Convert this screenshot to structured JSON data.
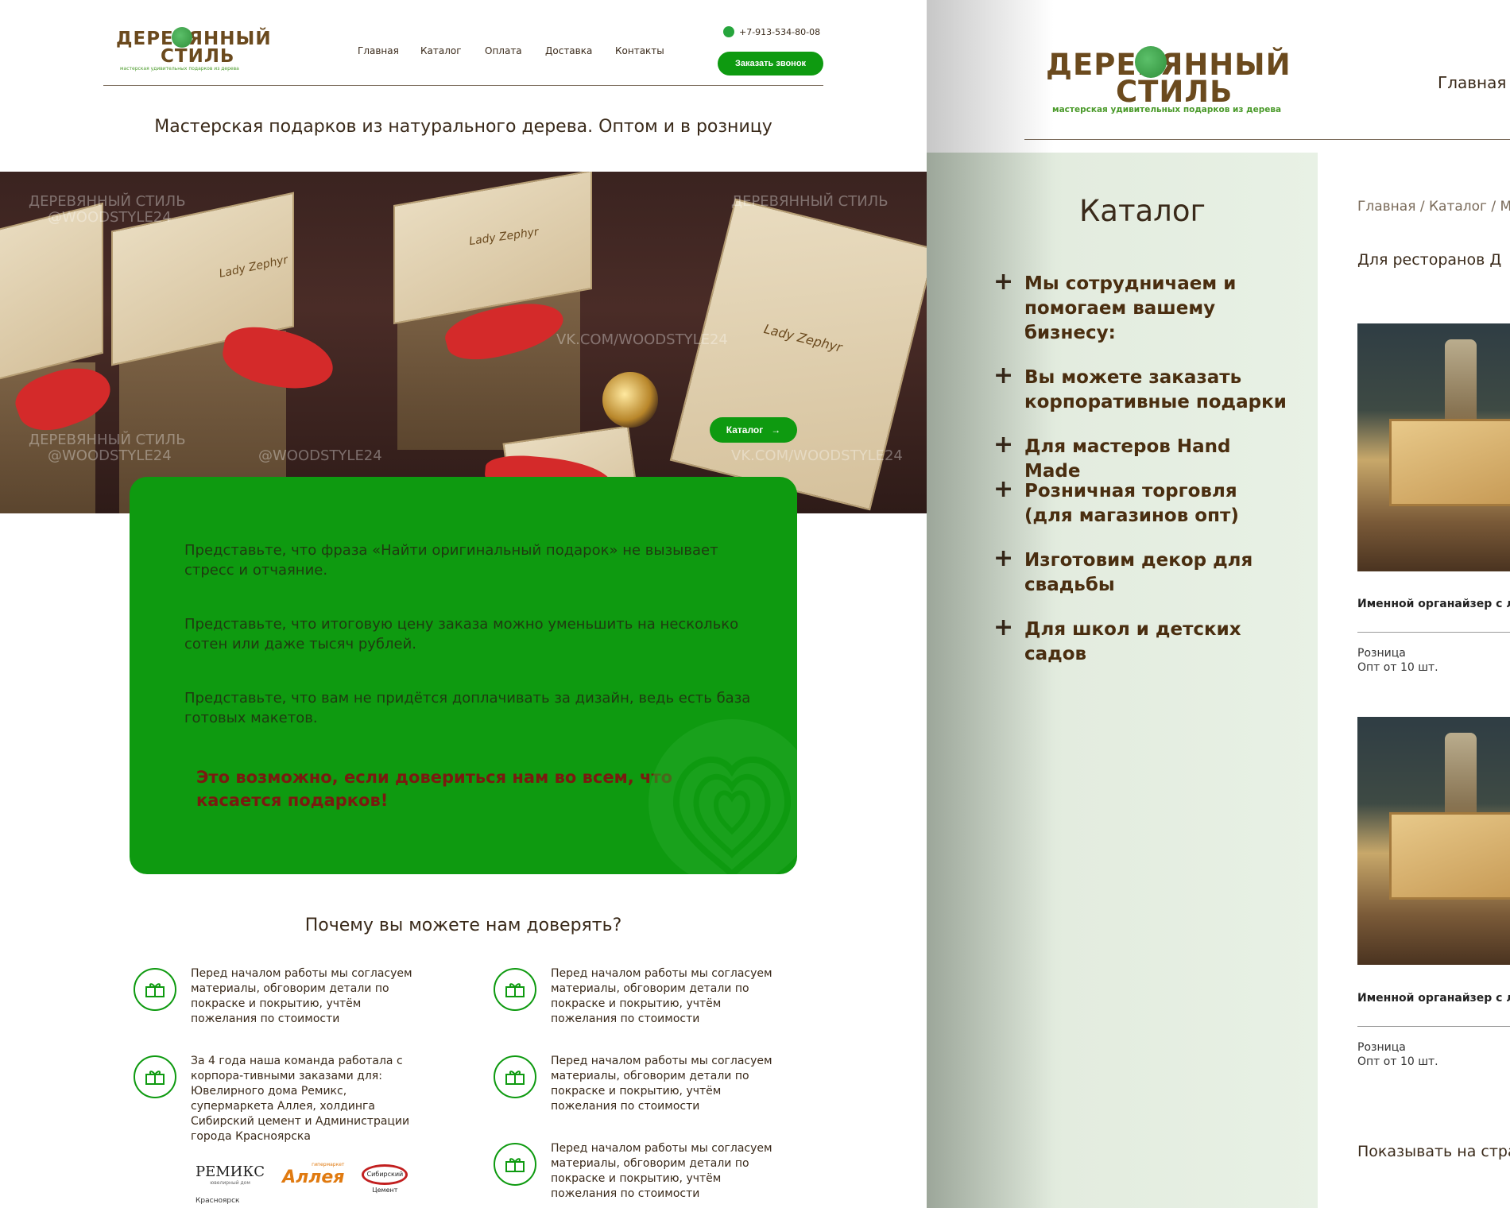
{
  "left": {
    "logo": {
      "line1": "ДЕРЕВЯННЫЙ",
      "line2": "СТИЛЬ",
      "sub": "мастерская удивительных подарков из дерева"
    },
    "nav": [
      "Главная",
      "Каталог",
      "Оплата",
      "Доставка",
      "Контакты"
    ],
    "phone": "+7-913-534-80-08",
    "call_button": "Заказать звонок",
    "tagline": "Мастерская подарков из натурального дерева. Оптом и в розницу",
    "hero": {
      "catalog_button": "Каталог",
      "watermarks": [
        "ДЕРЕВЯННЫЙ СТИЛЬ",
        "@WOODSTYLE24",
        "VK.COM/WOODSTYLE24"
      ],
      "box_labels": [
        "Lady Zephyr"
      ]
    },
    "card": {
      "p1": "Представьте, что фраза «Найти оригинальный подарок» не вызывает стресс и отчаяние.",
      "p2": "Представьте, что итоговую цену заказа можно уменьшить на несколько сотен или даже тысяч рублей.",
      "p3": "Представьте, что вам не придётся доплачивать за дизайн, ведь есть база готовых макетов.",
      "strong": "Это возможно, если довериться нам во всем, что касается подарков!"
    },
    "why": {
      "title": "Почему вы можете нам доверять?",
      "features": [
        "Перед началом работы мы согласуем материалы, обговорим детали по покраске и покрытию, учтём пожелания по стоимости",
        "Перед началом работы мы согласуем материалы, обговорим детали по покраске и покрытию, учтём пожелания по стоимости",
        "За 4 года наша команда работала с корпора-тивными заказами для: Ювелирного дома Ремикс, супермаркета Аллея, холдинга Сибирский цемент и Администрации города Красноярска",
        "Перед началом работы мы согласуем материалы, обговорим детали по покраске и покрытию, учтём пожелания по стоимости",
        "Перед началом работы мы согласуем материалы, обговорим детали по покраске и покрытию, учтём пожелания по стоимости"
      ],
      "partners": {
        "remix": "РЕМИКС",
        "remix_sub": "ювелирный дом",
        "alleya": "Аллея",
        "alleya_sub": "гипермаркет",
        "cement": "Сибирский Цемент",
        "admin": "Красноярск"
      }
    }
  },
  "right": {
    "logo": {
      "line1": "ДЕРЕВЯННЫЙ",
      "line2": "СТИЛЬ",
      "sub": "мастерская удивительных подарков из дерева"
    },
    "nav_first": "Главная",
    "sidebar": {
      "title": "Каталог",
      "items": [
        "Мы сотрудничаем и помогаем вашему бизнесу:",
        "Вы можете заказать корпоративные подарки",
        "Для мастеров Hand Made",
        "Розничная торговля (для магазинов опт)",
        "Изготовим декор для свадьбы",
        "Для школ и детских садов"
      ]
    },
    "breadcrumb": "Главная / Каталог / М",
    "filter": "Для ресторанов   Д",
    "products": [
      {
        "name": "Именной органайзер с ли",
        "retail": "Розница",
        "wholesale": "Опт от 10 шт."
      },
      {
        "name": "Именной органайзер с ли",
        "retail": "Розница",
        "wholesale": "Опт от 10 шт."
      }
    ],
    "show_per_page": "Показывать на стра"
  },
  "colors": {
    "brand_green": "#0e9a10",
    "brown": "#6b4a1e",
    "text": "#3a2a1a",
    "logo_green": "#4a9a2a",
    "accent_red": "#7a1a10"
  }
}
